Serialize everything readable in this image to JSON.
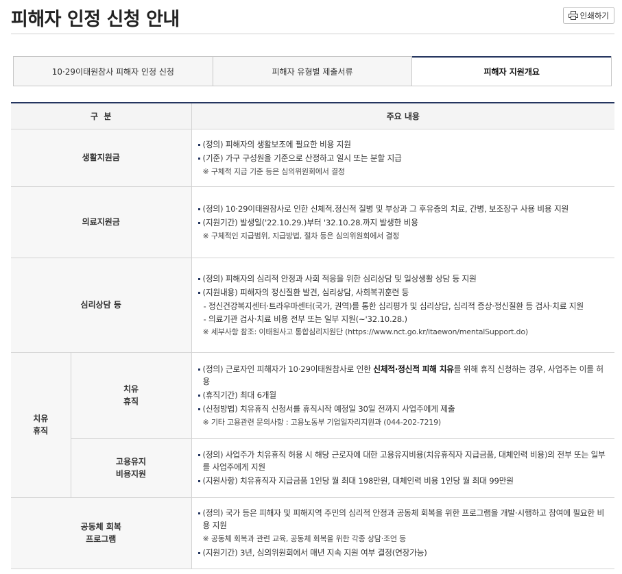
{
  "header": {
    "title": "피해자 인정 신청 안내",
    "print_label": "인쇄하기"
  },
  "tabs": [
    {
      "label": "10·29이태원참사 피해자 인정 신청"
    },
    {
      "label": "피해자 유형별 제출서류"
    },
    {
      "label": "피해자 지원개요"
    }
  ],
  "table": {
    "col_category": "구  분",
    "col_content": "주요 내용",
    "rows": {
      "living": {
        "category": "생활지원금",
        "items": [
          "(정의) 피해자의 생활보조에 필요한 비용 지원",
          "(기준) 가구 구성원을 기준으로 산정하고 일시 또는 분할 지급"
        ],
        "note": "※ 구체적 지급 기준 등은 심의위원회에서 결정"
      },
      "medical": {
        "category": "의료지원금",
        "items": [
          "(정의) 10·29이태원참사로 인한 신체적.정신적 질병 및 부상과 그 후유증의 치료, 간병, 보조장구 사용 비용 지원",
          "(지원기간) 발생일('22.10.29.)부터 '32.10.28.까지 발생한 비용"
        ],
        "note": "※ 구체적인 지급범위, 지급방법, 절차 등은 심의위원회에서 결정"
      },
      "counseling": {
        "category": "심리상담 등",
        "items": [
          "(정의) 피해자의 심리적 안정과 사회 적응을 위한 심리상담 및 일상생활 상담 등 지원",
          "(지원내용) 피해자의 정신질환 발견, 심리상담, 사회복귀훈련 등"
        ],
        "dash1": "- 정신건강복지센터·트라우마센터(국가, 권역)를 통한 심리평가 및 심리상담, 심리적 증상·정신질환 등 검사·치료 지원",
        "dash2": "- 의료기관 검사·치료 비용 전부 또는 일부 지원(~'32.10.28.)",
        "note": "※ 세부사항 참조: 이태원사고 통합심리지원단 (https://www.nct.go.kr/itaewon/mentalSupport.do)"
      },
      "leave": {
        "group": "치유\n휴직",
        "sub": "치유\n휴직",
        "item1_pre": "(정의) 근로자인 피해자가 10·29이태원참사로 인한 ",
        "item1_bold": "신체적·정신적 피해 치유",
        "item1_post": "를 위해 휴직 신청하는 경우, 사업주는 이를 허용",
        "item2": "(휴직기간) 최대 6개월",
        "item3": "(신청방법) 치유휴직 신청서를 휴직시작 예정일 30일 전까지 사업주에게 제출",
        "note": "※ 기타 고용관련 문의사항 : 고용노동부 기업일자리지원과 (044-202-7219)"
      },
      "employment": {
        "sub": "고용유지\n비용지원",
        "items": [
          "(정의) 사업주가 치유휴직 허용 시 해당 근로자에 대한 고용유지비용(치유휴직자 지급금품, 대체인력 비용)의 전부 또는 일부를 사업주에게 지원",
          "(지원사항) 치유휴직자 지급금품 1인당 월 최대 198만원, 대체인력 비용 1인당 월 최대 99만원"
        ]
      },
      "community": {
        "category": "공동체 회복\n프로그램",
        "item1": "(정의) 국가 등은 피해자 및 피해지역 주민의 심리적 안정과 공동체 회복을 위한 프로그램을 개발·시행하고 참여에 필요한 비용 지원",
        "note": "※ 공동체 회복과 관련 교육, 공동체 회복을 위한 각종 상담·조언 등",
        "item2": "(지원기간) 3년, 심의위원회에서 매년 지속 지원 여부 결정(연장가능)"
      }
    }
  },
  "icons": {
    "print": "printer-icon"
  },
  "colors": {
    "accent": "#24355f",
    "header_bg": "#f4f4f4",
    "border": "#d3d3d3"
  }
}
